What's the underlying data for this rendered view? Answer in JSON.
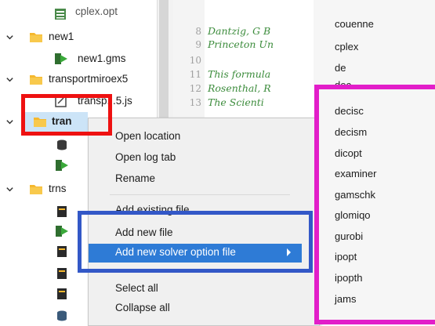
{
  "tree": {
    "items": [
      {
        "label": "cplex.opt",
        "icon": "option-file-icon",
        "bold": false
      },
      {
        "label": "new1",
        "icon": "folder-icon",
        "bold": false
      },
      {
        "label": "new1.gms",
        "icon": "gms-file-icon",
        "bold": false
      },
      {
        "label": "transportmiroex5",
        "icon": "folder-icon",
        "bold": false
      },
      {
        "label": "transp...5.js",
        "icon": "json-file-icon",
        "bold": false
      },
      {
        "label": "tran",
        "icon": "folder-icon",
        "bold": true
      },
      {
        "label": "trns",
        "icon": "folder-icon",
        "bold": false
      }
    ]
  },
  "editor": {
    "lines": [
      {
        "num": "8",
        "text": "Dantzig, G B"
      },
      {
        "num": "9",
        "text": "Princeton Un"
      },
      {
        "num": "10",
        "text": ""
      },
      {
        "num": "11",
        "text": "This formula"
      },
      {
        "num": "12",
        "text": "Rosenthal, R"
      },
      {
        "num": "13",
        "text": "The Scienti"
      }
    ]
  },
  "solver_list_top": [
    "couenne",
    "cplex",
    "de",
    "dec"
  ],
  "context_menu": {
    "items": [
      {
        "label": "Open location"
      },
      {
        "label": "Open log tab"
      },
      {
        "label": "Rename"
      },
      {
        "label": "Add existing file"
      },
      {
        "label": "Add new file"
      },
      {
        "label": "Add new solver option file",
        "highlighted": true,
        "has_submenu": true
      },
      {
        "label": "Select all"
      },
      {
        "label": "Collapse all"
      }
    ]
  },
  "solver_submenu": {
    "items": [
      "decisc",
      "decism",
      "dicopt",
      "examiner",
      "gamschk",
      "glomiqo",
      "gurobi",
      "ipopt",
      "ipopth",
      "jams"
    ]
  },
  "colors": {
    "highlight": "#2e7bd6",
    "annotation_red": "#ee1111",
    "annotation_blue": "#3358c7",
    "annotation_magenta": "#e21ec9",
    "folder": "#f5b82e",
    "gms_green": "#3aa93a",
    "code_green": "#3c8c3c"
  }
}
